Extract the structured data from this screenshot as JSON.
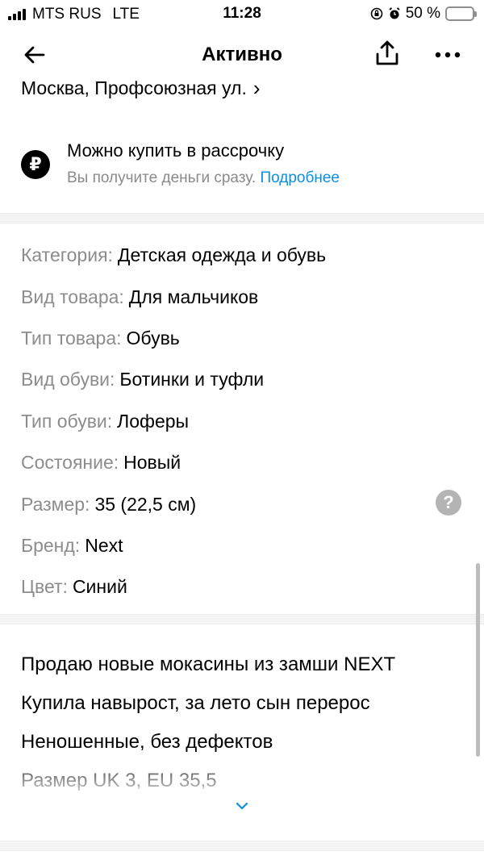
{
  "status_bar": {
    "carrier": "MTS RUS",
    "network": "LTE",
    "time": "11:28",
    "battery": "50 %",
    "battery_level": 0.5,
    "icons": [
      "signal-icon",
      "orientation-lock-icon",
      "alarm-icon",
      "battery-icon"
    ]
  },
  "nav": {
    "title": "Активно",
    "icons": [
      "back-arrow-icon",
      "share-icon",
      "more-icon"
    ]
  },
  "address": {
    "text": "Москва, Профсоюзная ул.",
    "chevron": "›"
  },
  "installment": {
    "icon": "ruble-icon",
    "title": "Можно купить в рассрочку",
    "subtitle": "Вы получите деньги сразу.",
    "link": "Подробнее"
  },
  "params": [
    {
      "label": "Категория:",
      "value": "Детская одежда и обувь"
    },
    {
      "label": "Вид товара:",
      "value": "Для мальчиков"
    },
    {
      "label": "Тип товара:",
      "value": "Обувь"
    },
    {
      "label": "Вид обуви:",
      "value": "Ботинки и туфли"
    },
    {
      "label": "Тип обуви:",
      "value": "Лоферы"
    },
    {
      "label": "Состояние:",
      "value": "Новый"
    },
    {
      "label": "Размер:",
      "value": "35 (22,5 см)",
      "help": "?"
    },
    {
      "label": "Бренд:",
      "value": "Next"
    },
    {
      "label": "Цвет:",
      "value": "Синий"
    }
  ],
  "description": {
    "lines": [
      "Продаю новые мокасины из замши NEXT",
      "Купила навырост, за лето сын перерос",
      "Неношенные, без дефектов",
      "Размер UK 3, EU 35,5"
    ],
    "expand_icon": "chevron-down-icon"
  },
  "colors": {
    "label_gray": "#8c8c8c",
    "link_blue": "#0a8ee6",
    "battery_yellow": "#ffcc00",
    "divider": "#f4f4f4"
  }
}
